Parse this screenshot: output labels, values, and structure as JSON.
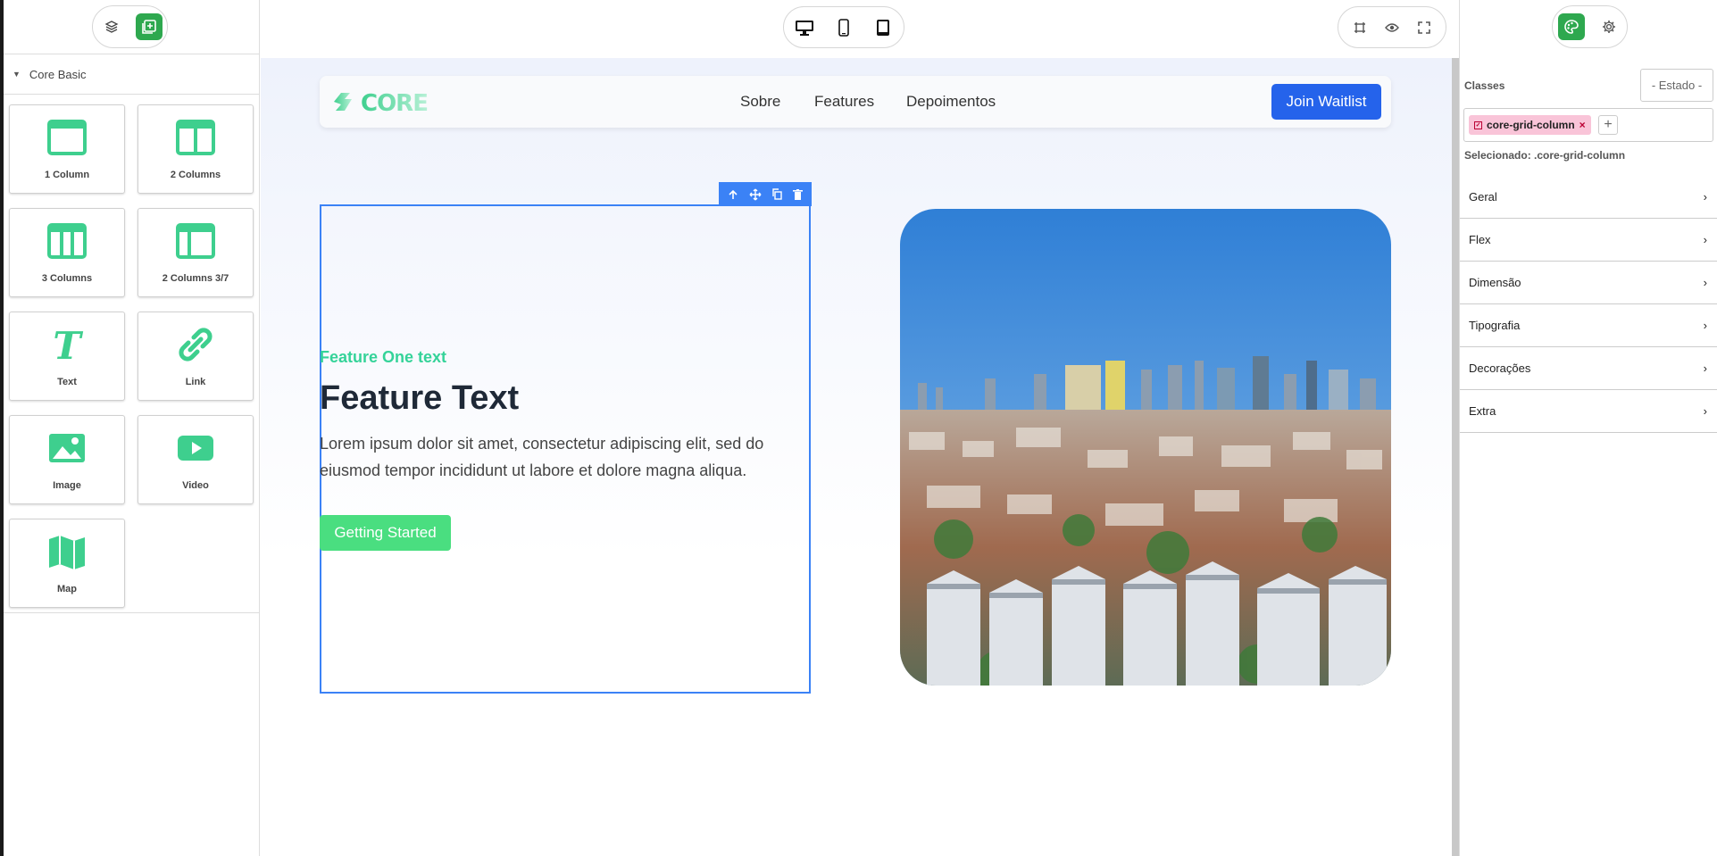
{
  "left_panel": {
    "category": "Core Basic",
    "blocks": [
      {
        "label": "1 Column",
        "icon": "one-column-icon"
      },
      {
        "label": "2 Columns",
        "icon": "two-columns-icon"
      },
      {
        "label": "3 Columns",
        "icon": "three-columns-icon"
      },
      {
        "label": "2 Columns 3/7",
        "icon": "two-columns-37-icon"
      },
      {
        "label": "Text",
        "icon": "text-icon"
      },
      {
        "label": "Link",
        "icon": "link-icon"
      },
      {
        "label": "Image",
        "icon": "image-icon"
      },
      {
        "label": "Video",
        "icon": "video-icon"
      },
      {
        "label": "Map",
        "icon": "map-icon"
      }
    ]
  },
  "page": {
    "logo_text": "CORE",
    "nav": [
      "Sobre",
      "Features",
      "Depoimentos"
    ],
    "join_button": "Join Waitlist",
    "feature_small": "Feature One text",
    "feature_title": "Feature Text",
    "feature_body": "Lorem ipsum dolor sit amet, consectetur adipiscing elit, sed do eiusmod tempor incididunt ut labore et dolore magna aliqua.",
    "cta_button": "Getting Started"
  },
  "right_panel": {
    "classes_label": "Classes",
    "state_select": "- Estado -",
    "class_tag": "core-grid-column",
    "selected_label": "Selecionado:",
    "selected_value": ".core-grid-column",
    "sections": [
      "Geral",
      "Flex",
      "Dimensão",
      "Tipografia",
      "Decorações",
      "Extra"
    ]
  },
  "colors": {
    "accent": "#2ea84f",
    "block_icon": "#3ecf8e",
    "selection": "#3b82f6",
    "join": "#2563eb",
    "cta": "#4ade80",
    "tag": "#f9c4d8"
  }
}
